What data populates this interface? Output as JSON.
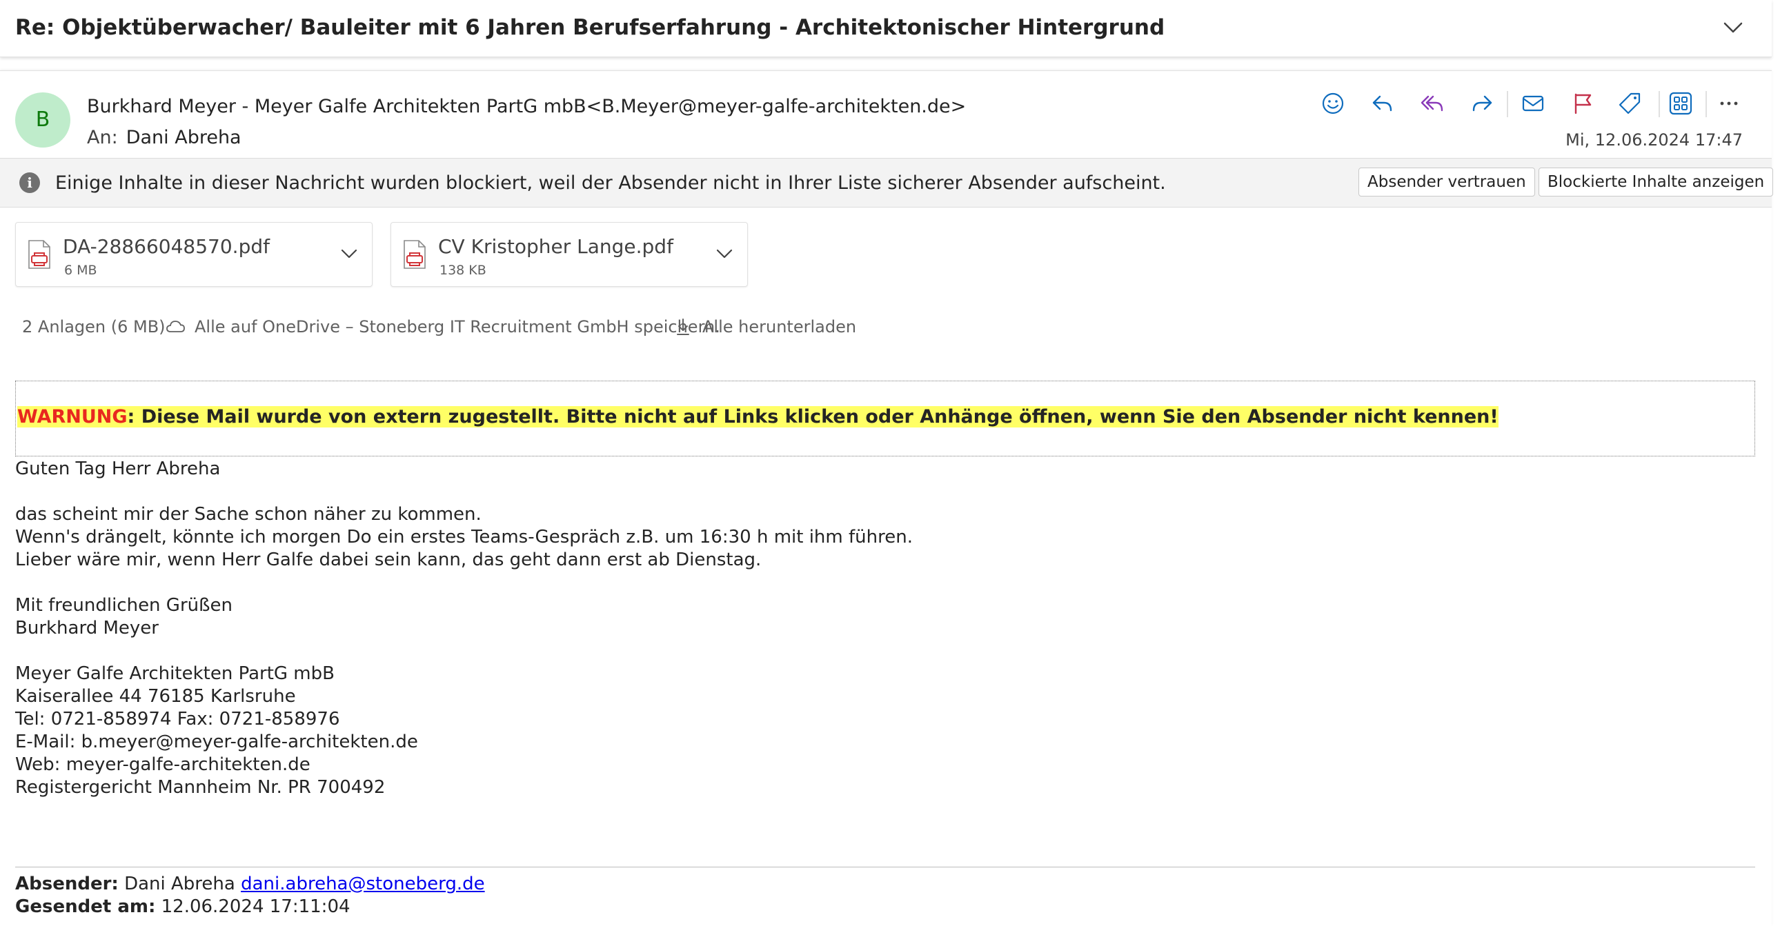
{
  "subject": "Re: Objektüberwacher/ Bauleiter mit 6 Jahren Berufserfahrung - Architektonischer Hintergrund",
  "sender": {
    "initial": "B",
    "from_line": "Burkhard Meyer - Meyer Galfe Architekten PartG mbB<B.Meyer@meyer-galfe-architekten.de>",
    "to_label": "An:",
    "to_name": "Dani Abreha",
    "date": "Mi, 12.06.2024 17:47",
    "avatar_bg": "#bfeccb",
    "avatar_fg": "#0e7a0d"
  },
  "toolbar": {
    "icons": [
      "emoji-icon",
      "reply-icon",
      "reply-all-icon",
      "forward-icon",
      "mark-unread-icon",
      "flag-icon",
      "tag-icon",
      "apps-icon",
      "more-icon"
    ]
  },
  "infobar": {
    "text": "Einige Inhalte in dieser Nachricht wurden blockiert, weil der Absender nicht in Ihrer Liste sicherer Absender aufscheint.",
    "trust_button": "Absender vertrauen",
    "show_button": "Blockierte Inhalte anzeigen"
  },
  "attachments": [
    {
      "name": "DA-28866048570.pdf",
      "size": "6 MB"
    },
    {
      "name": "CV Kristopher Lange.pdf",
      "size": "138 KB"
    }
  ],
  "attachment_summary": {
    "count": "2 Anlagen (6 MB)",
    "save_onedrive": "Alle auf OneDrive – Stoneberg IT Recruitment GmbH speichern.",
    "download_all": "Alle herunterladen"
  },
  "warning": {
    "label": "WARNUNG",
    "text": ": Diese Mail wurde von extern zugestellt. Bitte nicht auf Links klicken oder Anhänge öffnen, wenn Sie den Absender nicht kennen!",
    "label_color": "#e8281f",
    "highlight_color": "#ffff66"
  },
  "body": {
    "greeting": "Guten Tag Herr Abreha",
    "p1_l1": "das scheint mir der Sache schon näher zu kommen.",
    "p1_l2": "Wenn's drängelt, könnte ich morgen Do ein erstes Teams-Gespräch z.B. um 16:30 h mit ihm führen.",
    "p1_l3": "Lieber wäre mir, wenn Herr Galfe dabei sein kann, das geht dann erst ab Dienstag.",
    "closing": "Mit freundlichen Grüßen",
    "signature_name": "Burkhard Meyer",
    "company": "Meyer Galfe Architekten PartG mbB",
    "address": "Kaiserallee 44  76185 Karlsruhe",
    "phone": "Tel: 0721-858974  Fax: 0721-858976",
    "email": "E-Mail: b.meyer@meyer-galfe-architekten.de",
    "web": "Web: meyer-galfe-architekten.de",
    "register": "Registergericht Mannheim Nr. PR 700492"
  },
  "quoted": {
    "sender_label": "Absender:",
    "sender_name": "Dani Abreha",
    "sender_email": "dani.abreha@stoneberg.de",
    "sent_label": "Gesendet am:",
    "sent_value": "12.06.2024 17:11:04"
  }
}
